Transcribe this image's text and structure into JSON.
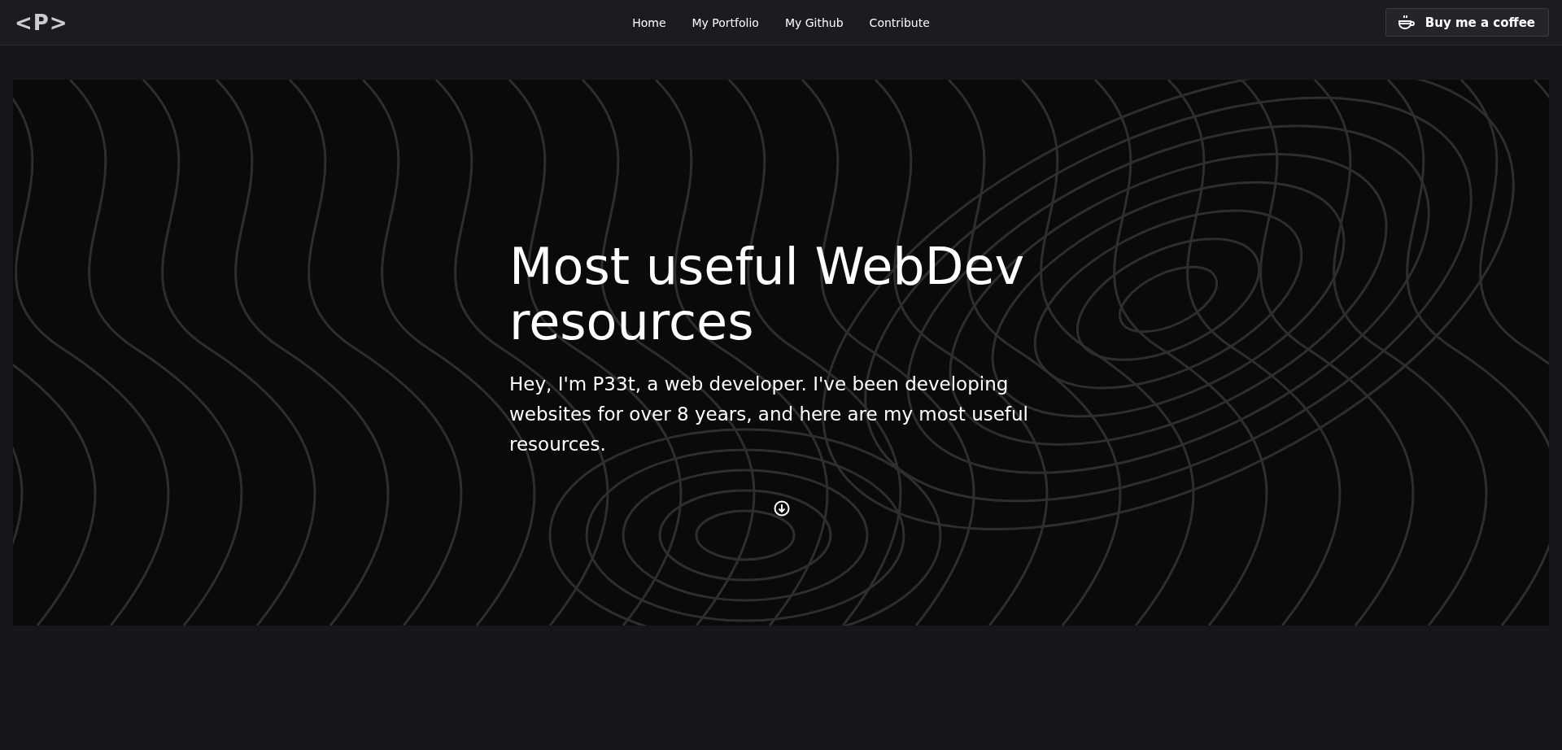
{
  "navbar": {
    "logo": "<P>",
    "links": [
      {
        "label": "Home"
      },
      {
        "label": "My Portfolio"
      },
      {
        "label": "My Github"
      },
      {
        "label": "Contribute"
      }
    ],
    "button": "Buy me a coffee"
  },
  "hero": {
    "title": "Most useful WebDev resources",
    "text": "Hey, I'm P33t, a web developer. I've been developing websites for over 8 years, and here are my most useful resources."
  }
}
